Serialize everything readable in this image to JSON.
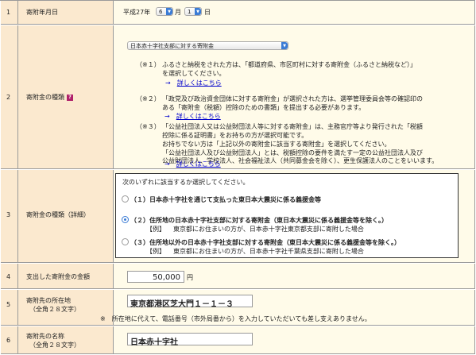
{
  "row1": {
    "num": "1",
    "label": "寄附年月日",
    "era": "平成27年",
    "month": "6",
    "month_unit": "月",
    "day": "1",
    "day_unit": "日"
  },
  "row2": {
    "num": "2",
    "label": "寄附金の種類",
    "help": "?",
    "select_value": "日本赤十字社支部に対する寄附金",
    "note1_mark": "（※１）",
    "note1_l1": "ふるさと納税をされた方は、「都道府県、市区町村に対する寄附金（ふるさと納税など）」",
    "note1_l2": "を選択してください。",
    "link_arrow": "→",
    "link_text": "詳しくはこちら",
    "note2_mark": "（※２）",
    "note2_l1": "「政党及び政治資金団体に対する寄附金」が選択された方は、選挙管理委員会等の確認印の",
    "note2_l2": "ある「寄附金（税額）控除のための書類」を提出する必要があります。",
    "note3_mark": "（※３）",
    "note3_l1": "「公益社団法人又は公益財団法人等に対する寄附金」は、主務官庁等より発行された「税額",
    "note3_l2": "控除に係る証明書」をお持ちの方が選択可能です。",
    "note3_l3": "お持ちでない方は「上記以外の寄附金に該当する寄附金」を選択してください。",
    "note3_l4": "「公益社団法人及び公益財団法人」とは、税額控除の要件を満たす一定の公益社団法人及び",
    "note3_l5": "公益財団法人、学校法人、社会福祉法人（共同募金会を除く）、更生保護法人のことをいいます。"
  },
  "row3": {
    "num": "3",
    "label": "寄附金の種類（詳細）",
    "prompt": "次のいずれに該当するか選択してください。",
    "opt1": "（１）日本赤十字社を通じて支払った東日本大震災に係る義援金等",
    "opt2": "（２）住所地の日本赤十字社支部に対する寄附金（東日本大震災に係る義援金等を除く。）",
    "opt2_ex_tag": "【例】",
    "opt2_ex": "東京都にお住まいの方が、日本赤十字社東京都支部に寄附した場合",
    "opt3": "（３）住所地以外の日本赤十字社支部に対する寄附金（東日本大震災に係る義援金等を除く。）",
    "opt3_ex_tag": "【例】",
    "opt3_ex": "東京都にお住まいの方が、日本赤十字社千葉県支部に寄附した場合"
  },
  "row4": {
    "num": "4",
    "label": "支出した寄附金の金額",
    "amount": "50,000",
    "unit": "円"
  },
  "row5": {
    "num": "5",
    "label_l1": "寄附先の所在地",
    "label_l2": "（全角２８文字）",
    "value": "東京都港区芝大門１－１－３",
    "note": "※　所在地に代えて、電話番号（市外局番から）を入力していただいても差し支えありません。"
  },
  "row6": {
    "num": "6",
    "label_l1": "寄附先の名称",
    "label_l2": "（全角２８文字）",
    "value": "日本赤十字社"
  }
}
